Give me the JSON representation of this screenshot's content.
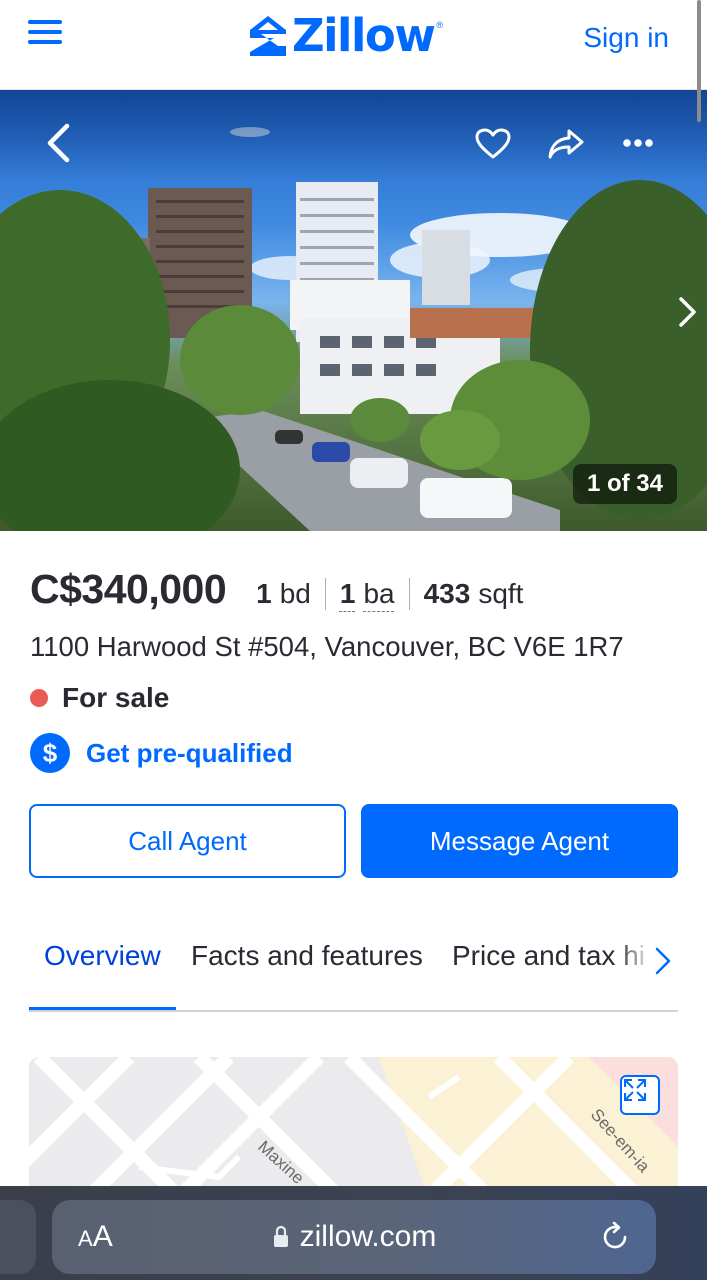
{
  "header": {
    "logo_text": "Zillow",
    "logo_mark": "®",
    "sign_in_label": "Sign in",
    "menu_icon": "hamburger-menu-icon"
  },
  "photo": {
    "counter": "1 of 34",
    "icons": [
      "back-chevron-icon",
      "heart-icon",
      "share-icon",
      "more-icon",
      "next-chevron-icon"
    ]
  },
  "listing": {
    "price": "C$340,000",
    "beds_value": "1",
    "beds_unit": "bd",
    "baths_value": "1",
    "baths_unit": "ba",
    "sqft_value": "433",
    "sqft_unit": "sqft",
    "address": "1100 Harwood St #504, Vancouver, BC V6E 1R7",
    "status": "For sale",
    "status_color": "#eb5a54",
    "prequal_icon_glyph": "$",
    "prequal_label": "Get pre-qualified"
  },
  "actions": {
    "call_label": "Call Agent",
    "message_label": "Message Agent"
  },
  "tabs": [
    {
      "label": "Overview",
      "active": true
    },
    {
      "label": "Facts and features",
      "active": false
    },
    {
      "label": "Price and tax hi",
      "active": false
    }
  ],
  "map": {
    "streets": [
      "Maxine",
      "See-em-ia"
    ]
  },
  "browser": {
    "text_size_label_small": "A",
    "text_size_label_large": "A",
    "url": "zillow.com",
    "lock_icon": "lock-icon",
    "reload_icon": "reload-icon"
  },
  "colors": {
    "accent": "#006aff",
    "text": "#2a2a33"
  }
}
